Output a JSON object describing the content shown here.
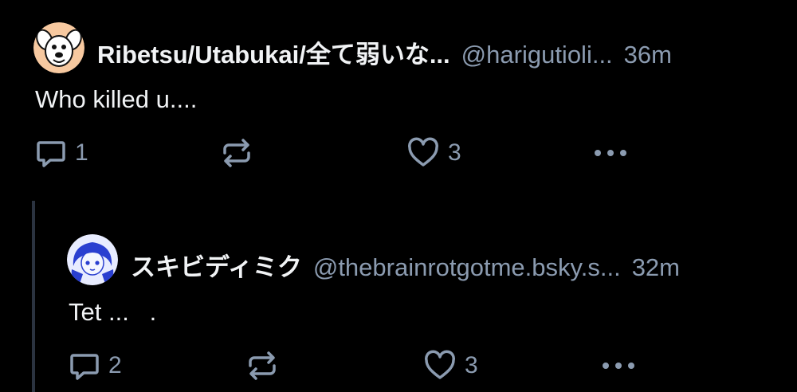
{
  "posts": [
    {
      "display_name": "Ribetsu/Utabukai/全て弱いな...",
      "handle": "@harigutioli...",
      "time": "36m",
      "text": "Who killed u....",
      "reply_count": "1",
      "repost_count": "",
      "like_count": "3",
      "avatar_icon": "cartoon-dog-avatar"
    },
    {
      "display_name": "スキビディミク",
      "handle": "@thebrainrotgotme.bsky.s...",
      "time": "32m",
      "text": "Tet ...   .",
      "reply_count": "2",
      "repost_count": "",
      "like_count": "3",
      "avatar_icon": "anime-girl-avatar"
    }
  ],
  "colors": {
    "background": "#000000",
    "text": "#f1f3f5",
    "muted": "#8b9bb0",
    "thread_line": "#2b3340"
  }
}
